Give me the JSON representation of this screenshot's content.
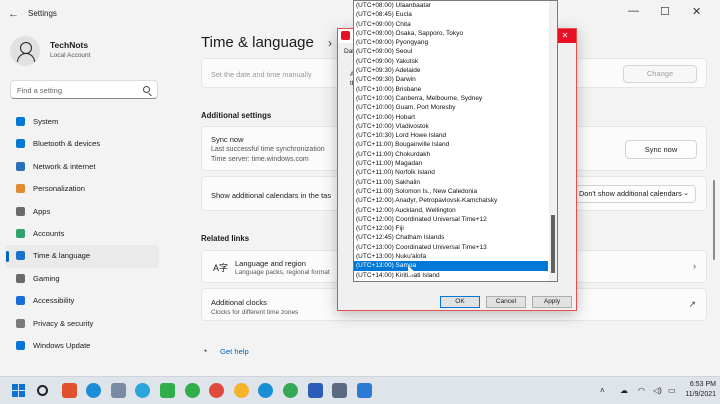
{
  "window": {
    "title": "Settings",
    "back_icon": "back-arrow-icon"
  },
  "profile": {
    "name": "TechNots",
    "account": "Local Account"
  },
  "search": {
    "placeholder": "Find a setting"
  },
  "nav": {
    "items": [
      {
        "label": "System",
        "icon": "system-icon",
        "color": "#0078d4"
      },
      {
        "label": "Bluetooth & devices",
        "icon": "bluetooth-icon",
        "color": "#0078d4"
      },
      {
        "label": "Network & internet",
        "icon": "wifi-icon",
        "color": "#2a6fb8"
      },
      {
        "label": "Personalization",
        "icon": "brush-icon",
        "color": "#e08a32"
      },
      {
        "label": "Apps",
        "icon": "apps-icon",
        "color": "#6a6a6a"
      },
      {
        "label": "Accounts",
        "icon": "accounts-icon",
        "color": "#2fa36b"
      },
      {
        "label": "Time & language",
        "icon": "globe-clock-icon",
        "color": "#1a73c8"
      },
      {
        "label": "Gaming",
        "icon": "gaming-icon",
        "color": "#6a6a6a"
      },
      {
        "label": "Accessibility",
        "icon": "accessibility-icon",
        "color": "#1a6ed8"
      },
      {
        "label": "Privacy & security",
        "icon": "shield-icon",
        "color": "#7a7a7a"
      },
      {
        "label": "Windows Update",
        "icon": "update-icon",
        "color": "#0a74d6"
      }
    ]
  },
  "main": {
    "title": "Time & language",
    "set_manual": {
      "label": "Set the date and time manually",
      "button": "Change"
    },
    "additional_settings": "Additional settings",
    "sync": {
      "title": "Sync now",
      "line1": "Last successful time synchronization",
      "line2": "Time server: time.windows.com",
      "button": "Sync now"
    },
    "calendars": {
      "label": "Show additional calendars in the tas",
      "value": "Don't show additional calendars"
    },
    "related_links": "Related links",
    "language_region": {
      "title": "Language and region",
      "subtitle": "Language packs, regional format"
    },
    "additional_clocks": {
      "title": "Additional clocks",
      "subtitle": "Clocks for different time zones"
    },
    "get_help": "Get help"
  },
  "dialog": {
    "frag_top": "Dat",
    "frag_a": "A",
    "frag_b": "th",
    "buttons": {
      "ok": "OK",
      "cancel": "Cancel",
      "apply": "Apply"
    }
  },
  "timezones": [
    "(UTC+08:00) Ulaanbaatar",
    "(UTC+08:45) Eucla",
    "(UTC+09:00) Chita",
    "(UTC+09:00) Osaka, Sapporo, Tokyo",
    "(UTC+09:00) Pyongyang",
    "(UTC+09:00) Seoul",
    "(UTC+09:00) Yakutsk",
    "(UTC+09:30) Adelaide",
    "(UTC+09:30) Darwin",
    "(UTC+10:00) Brisbane",
    "(UTC+10:00) Canberra, Melbourne, Sydney",
    "(UTC+10:00) Guam, Port Moresby",
    "(UTC+10:00) Hobart",
    "(UTC+10:00) Vladivostok",
    "(UTC+10:30) Lord Howe Island",
    "(UTC+11:00) Bougainville Island",
    "(UTC+11:00) Chokurdakh",
    "(UTC+11:00) Magadan",
    "(UTC+11:00) Norfolk Island",
    "(UTC+11:00) Sakhalin",
    "(UTC+11:00) Solomon Is., New Caledonia",
    "(UTC+12:00) Anadyr, Petropavlovsk-Kamchatsky",
    "(UTC+12:00) Auckland, Wellington",
    "(UTC+12:00) Coordinated Universal Time+12",
    "(UTC+12:00) Fiji",
    "(UTC+12:45) Chatham Islands",
    "(UTC+13:00) Coordinated Universal Time+13",
    "(UTC+13:00) Nuku'alofa",
    "(UTC+13:00) Samoa",
    "(UTC+14:00) Kiritimati Island"
  ],
  "timezone_selected_index": 28,
  "taskbar": {
    "time": "6:53 PM",
    "date": "11/9/2021",
    "apps": [
      {
        "icon": "search-icon",
        "color": "#222222"
      },
      {
        "icon": "snip-tool-icon",
        "color": "#e0502c"
      },
      {
        "icon": "edge-icon",
        "color": "#1b8ed6"
      },
      {
        "icon": "file-explorer-icon",
        "color": "#7a8aa0"
      },
      {
        "icon": "edge-icon",
        "color": "#2aa7d8"
      },
      {
        "icon": "camtasia-icon",
        "color": "#2fae4a"
      },
      {
        "icon": "chrome-icon",
        "color": "#2fae4a"
      },
      {
        "icon": "chrome-icon",
        "color": "#e04a3c"
      },
      {
        "icon": "chrome-icon",
        "color": "#f3b42c"
      },
      {
        "icon": "edge-icon",
        "color": "#1b8ed6"
      },
      {
        "icon": "chrome-icon",
        "color": "#34a853"
      },
      {
        "icon": "word-icon",
        "color": "#2b5cb8"
      },
      {
        "icon": "settings-gear-icon",
        "color": "#5a6a80"
      },
      {
        "icon": "clipboard-icon",
        "color": "#2a7ad6"
      }
    ]
  }
}
